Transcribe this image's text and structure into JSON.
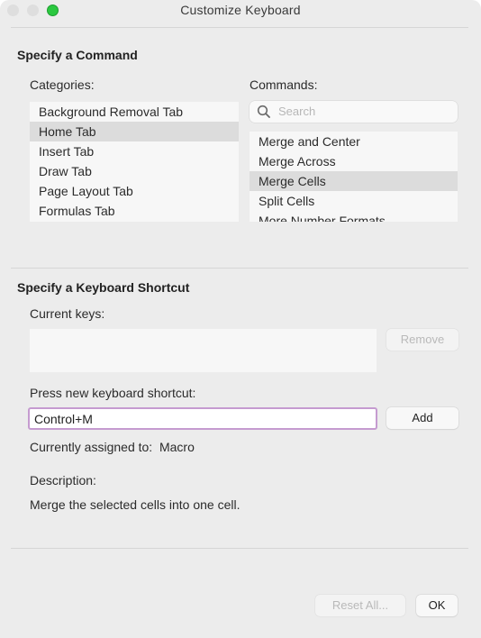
{
  "window": {
    "title": "Customize Keyboard"
  },
  "command_section": {
    "title": "Specify a Command",
    "categories_label": "Categories:",
    "categories": [
      {
        "label": "Background Removal Tab",
        "selected": false
      },
      {
        "label": "Home Tab",
        "selected": true
      },
      {
        "label": "Insert Tab",
        "selected": false
      },
      {
        "label": "Draw Tab",
        "selected": false
      },
      {
        "label": "Page Layout Tab",
        "selected": false
      },
      {
        "label": "Formulas Tab",
        "selected": false
      }
    ],
    "commands_label": "Commands:",
    "search_placeholder": "Search",
    "commands": [
      {
        "label": "Merge and Center",
        "selected": false
      },
      {
        "label": "Merge Across",
        "selected": false
      },
      {
        "label": "Merge Cells",
        "selected": true
      },
      {
        "label": "Split Cells",
        "selected": false
      },
      {
        "label": "More Number Formats",
        "selected": false
      }
    ]
  },
  "shortcut_section": {
    "title": "Specify a Keyboard Shortcut",
    "current_keys_label": "Current keys:",
    "remove_label": "Remove",
    "press_new_label": "Press new keyboard shortcut:",
    "shortcut_value": "Control+M",
    "add_label": "Add",
    "assigned_label": "Currently assigned to:",
    "assigned_value": "Macro",
    "description_label": "Description:",
    "description_text": "Merge the selected cells into one cell."
  },
  "footer": {
    "reset_label": "Reset All...",
    "ok_label": "OK"
  },
  "colors": {
    "selection": "#dcdcdc",
    "focus_ring": "#c59bd0",
    "zoom_button": "#2bc840"
  }
}
